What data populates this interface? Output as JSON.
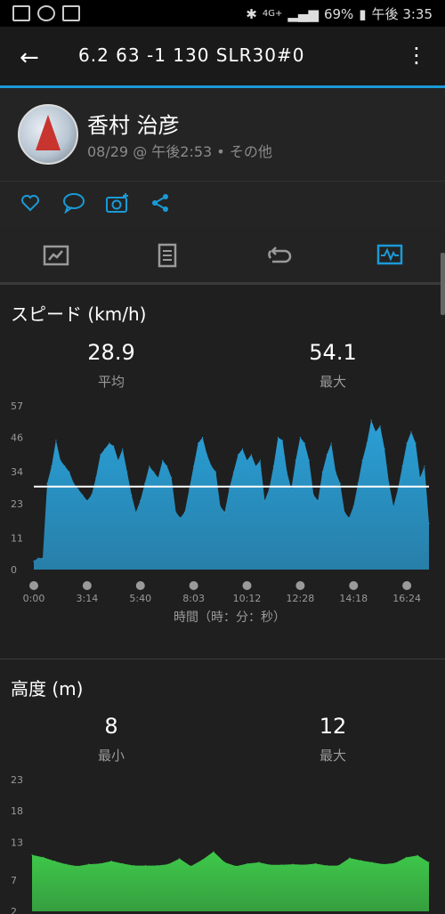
{
  "status": {
    "battery": "69%",
    "time": "午後 3:35",
    "network": "4G+"
  },
  "appbar": {
    "title": "6.2  63  -1  130  SLR30#0"
  },
  "profile": {
    "name": "香村 治彦",
    "subtitle": "08/29 @ 午後2:53 • その他"
  },
  "actions": [
    "heart-icon",
    "comment-icon",
    "camera-add-icon",
    "share-icon"
  ],
  "tabs": [
    "summary-icon",
    "details-icon",
    "laps-icon",
    "charts-icon"
  ],
  "speed": {
    "title": "スピード (km/h)",
    "avg_value": "28.9",
    "avg_label": "平均",
    "max_value": "54.1",
    "max_label": "最大",
    "xlabel": "時間（時：分：秒）"
  },
  "altitude": {
    "title": "高度 (m)",
    "min_value": "8",
    "min_label": "最小",
    "max_value": "12",
    "max_label": "最大"
  },
  "chart_data": [
    {
      "type": "area",
      "title": "スピード (km/h)",
      "xlabel": "時間（時：分：秒）",
      "xticks": [
        "0:00",
        "3:14",
        "5:40",
        "8:03",
        "10:12",
        "12:28",
        "14:18",
        "16:24"
      ],
      "yticks": [
        0,
        11,
        23,
        34,
        46,
        57
      ],
      "ylim": [
        0,
        57
      ],
      "reference_line": 28.9,
      "color": "#2a9fd6",
      "x": [
        0,
        0.2,
        0.4,
        0.6,
        0.8,
        1.0,
        1.2,
        1.4,
        1.6,
        1.8,
        2.0,
        2.2,
        2.4,
        2.6,
        2.8,
        3.0,
        3.2,
        3.4,
        3.6,
        3.8,
        4.0,
        4.2,
        4.4,
        4.6,
        4.8,
        5.0,
        5.2,
        5.4,
        5.6,
        5.8,
        6.0,
        6.2,
        6.4,
        6.6,
        6.8,
        7.0,
        7.2,
        7.4,
        7.6,
        7.8,
        8.0,
        8.2,
        8.4,
        8.6,
        8.8,
        9.0,
        9.2,
        9.4,
        9.6,
        9.8,
        10.0,
        10.2,
        10.4,
        10.6,
        10.8,
        11.0,
        11.2,
        11.4,
        11.6,
        11.8,
        12.0,
        12.2,
        12.4,
        12.6,
        12.8,
        13.0,
        13.2,
        13.4,
        13.6,
        13.8,
        14.0,
        14.2,
        14.4,
        14.6,
        14.8,
        15.0,
        15.2,
        15.4,
        15.6,
        15.8,
        16.0,
        16.2,
        16.4,
        16.6,
        16.8,
        17.0,
        17.2,
        17.4,
        17.6,
        17.8
      ],
      "values": [
        3,
        4,
        4,
        30,
        36,
        45,
        38,
        36,
        34,
        30,
        28,
        26,
        24,
        26,
        32,
        40,
        42,
        44,
        43,
        38,
        42,
        34,
        26,
        20,
        24,
        30,
        36,
        34,
        32,
        38,
        36,
        32,
        20,
        18,
        20,
        28,
        36,
        44,
        46,
        40,
        36,
        34,
        22,
        20,
        28,
        34,
        40,
        42,
        38,
        40,
        36,
        38,
        24,
        28,
        36,
        46,
        45,
        34,
        28,
        38,
        46,
        44,
        38,
        26,
        24,
        34,
        40,
        44,
        34,
        30,
        20,
        18,
        22,
        30,
        38,
        44,
        52,
        48,
        50,
        42,
        30,
        22,
        28,
        36,
        44,
        48,
        44,
        32,
        36,
        16
      ]
    },
    {
      "type": "area",
      "title": "高度 (m)",
      "yticks": [
        2,
        7,
        13,
        18,
        23
      ],
      "ylim": [
        2,
        23
      ],
      "color": "#3ec94a",
      "x": [
        0,
        0.5,
        1,
        1.5,
        2,
        2.5,
        3,
        3.5,
        4,
        4.5,
        5,
        5.5,
        6,
        6.5,
        7,
        7.5,
        8,
        8.5,
        9,
        9.5,
        10,
        10.5,
        11,
        11.5,
        12,
        12.5,
        13,
        13.5,
        14,
        14.5,
        15,
        15.5,
        16,
        16.5,
        17,
        17.5
      ],
      "values": [
        11,
        10.6,
        10,
        9.5,
        9.2,
        9.5,
        9.6,
        10,
        9.6,
        9.3,
        9.3,
        9.3,
        9.5,
        10.4,
        9.2,
        10.2,
        11.5,
        9.8,
        9.2,
        9.6,
        9.8,
        9.4,
        9.4,
        9.5,
        9.4,
        9.6,
        9.3,
        9.3,
        10.5,
        10.1,
        9.8,
        9.5,
        9.7,
        10.6,
        10.9,
        9.8
      ]
    }
  ]
}
